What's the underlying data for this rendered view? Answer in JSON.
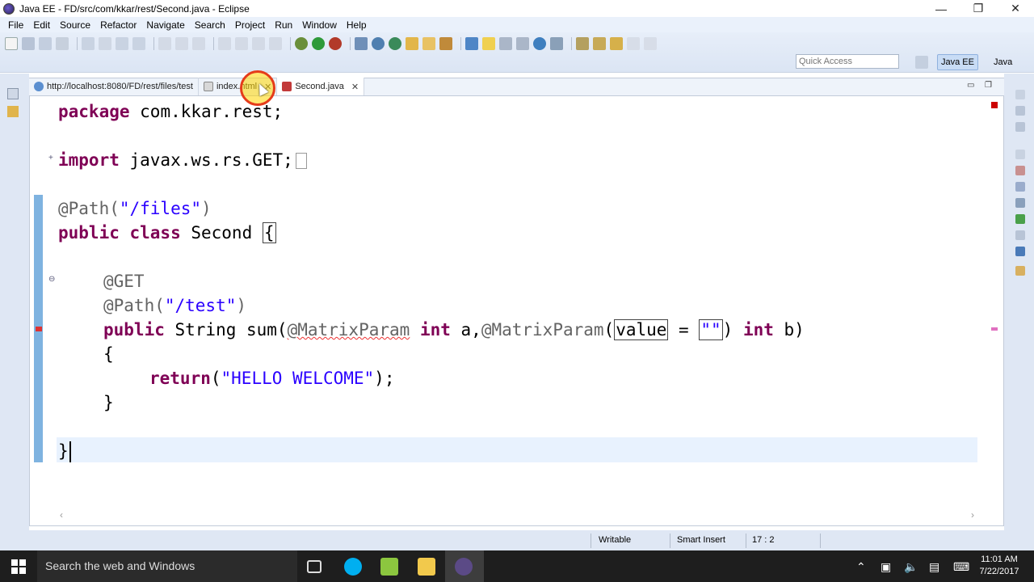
{
  "window": {
    "title": "Java EE - FD/src/com/kkar/rest/Second.java - Eclipse",
    "minimize_glyph": "—",
    "restore_glyph": "❐",
    "close_glyph": "✕"
  },
  "menu": {
    "items": [
      "File",
      "Edit",
      "Source",
      "Refactor",
      "Navigate",
      "Search",
      "Project",
      "Run",
      "Window",
      "Help"
    ]
  },
  "toolbar": {
    "quick_access_placeholder": "Quick Access",
    "perspectives": {
      "java_ee": "Java EE",
      "java": "Java"
    }
  },
  "editor": {
    "tabs": [
      {
        "label": "http://localhost:8080/FD/rest/files/test",
        "icon": "globe-icon",
        "active": false
      },
      {
        "label": "index.html",
        "icon": "html-file-icon",
        "active": false
      },
      {
        "label": "Second.java",
        "icon": "java-file-icon",
        "active": true
      }
    ],
    "tab_close_glyph": "✕",
    "code": {
      "line_package": {
        "kw": "package",
        "rest": " com.kkar.rest;"
      },
      "line_import": {
        "kw": "import",
        "rest": " javax.ws.rs.GET;"
      },
      "line_path_class": {
        "ann": "@Path(",
        "str": "\"/files\"",
        "end": ")"
      },
      "line_class": {
        "kw1": "public",
        "kw2": " class",
        "rest": " Second ",
        "brace": "{"
      },
      "line_get": {
        "ann": "@GET"
      },
      "line_path_method": {
        "ann": "@Path(",
        "str": "\"/test\"",
        "end": ")"
      },
      "line_method": {
        "kw1": "public",
        "mid1": " String sum(",
        "ann1": "@MatrixParam",
        "kw2": " int",
        "mid2": " a,",
        "ann2": "@MatrixParam",
        "paren": "(",
        "boxed_name": "value",
        "eq": " = ",
        "boxed_str": "\"\"",
        "close": ")",
        "kw3": " int",
        "end": " b)"
      },
      "line_open": "{",
      "line_return": {
        "kw": "return",
        "open": "(",
        "str": "\"HELLO WELCOME\"",
        "end": ");"
      },
      "line_close_method": "}",
      "line_close_class": "}"
    }
  },
  "status": {
    "writable": "Writable",
    "insert_mode": "Smart Insert",
    "position": "17 : 2"
  },
  "taskbar": {
    "search_placeholder": "Search the web and Windows",
    "time": "11:01 AM",
    "date": "7/22/2017"
  },
  "colors": {
    "keyword": "#7f0055",
    "string": "#2a00ff",
    "annotation": "#646464",
    "current_line": "#e8f2fe",
    "ruler": "#7fb3e0"
  }
}
